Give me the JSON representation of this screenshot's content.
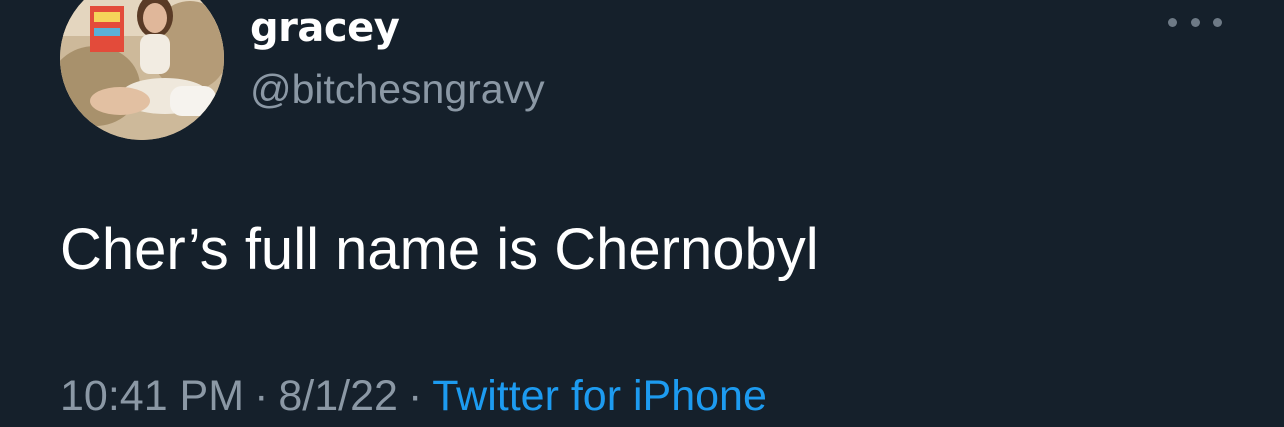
{
  "tweet": {
    "author": {
      "display_name": "gracey",
      "handle": "@bitchesngravy"
    },
    "text": "Cher’s full name is Chernobyl",
    "time": "10:41 PM",
    "date": "8/1/22",
    "separator": "·",
    "source": "Twitter for iPhone"
  },
  "icons": {
    "more": "more-options-icon"
  },
  "colors": {
    "background": "#15202b",
    "primary_text": "#ffffff",
    "secondary_text": "#8b98a5",
    "link": "#1d9bf0"
  }
}
